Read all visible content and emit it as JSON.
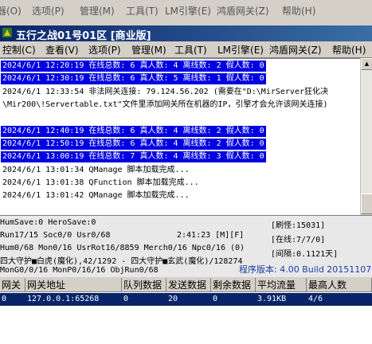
{
  "background_menu": {
    "items": [
      "器(O)",
      "选项(P)",
      "管理(M)",
      "工具(T)",
      "LM引擎(E)",
      "鸿盾网关(Z)",
      "帮助(H)"
    ]
  },
  "window": {
    "title": "五行之战01号01区 [商业版]"
  },
  "menu": {
    "items": [
      "控制(C)",
      "查看(V)",
      "选项(P)",
      "管理(M)",
      "工具(T)",
      "LM引擎(E)",
      "鸿盾网关(Z)",
      "帮助(H)"
    ]
  },
  "log": {
    "lines": [
      {
        "text": "2024/6/1 12:20:19 在线总数: 6 真人数: 4 离线数: 2 假人数: 0",
        "highlight": true
      },
      {
        "text": "2024/6/1 12:30:19 在线总数: 6 真人数: 5 离线数: 1 假人数: 0",
        "highlight": true
      },
      {
        "text": "2024/6/1 12:33:54 非法网关连接: 79.124.56.202 (需要在\"D:\\MirServer狂化决\\Mir200\\!Servertable.txt\"文件里添加网关所在机器的IP，引擎才会允许该网关连接)",
        "highlight": false
      },
      {
        "text": "2024/6/1 12:40:19 在线总数: 6 真人数: 4 离线数: 2 假人数: 0",
        "highlight": true
      },
      {
        "text": "2024/6/1 12:50:19 在线总数: 6 真人数: 4 离线数: 2 假人数: 0",
        "highlight": true
      },
      {
        "text": "2024/6/1 13:00:19 在线总数: 7 真人数: 4 离线数: 3 假人数: 0",
        "highlight": true
      },
      {
        "text": "2024/6/1 13:01:34 QManage 脚本加载完成...",
        "highlight": false
      },
      {
        "text": "2024/6/1 13:01:38 QFunction 脚本加载完成...",
        "highlight": false
      },
      {
        "text": "2024/6/1 13:01:42 QManage 脚本加载完成...",
        "highlight": false
      }
    ]
  },
  "status": {
    "save": "HumSave:0 HeroSave:0",
    "run": "Run17/15 Soc0/0 Usr0/68",
    "time": "2:41:23 [M][F]",
    "hum": "Hum0/68 Mon0/16 UsrRot16/8859 Merch0/16 Npc0/16 (0)",
    "map": "四大守护■白虎(魔化),42/1292 - 四大守护■玄武(魔化)/128274",
    "mon": "MonG0/0/16 MonP0/16/16 ObjRun0/68",
    "refresh": "[刷怪:15031]",
    "online": "[在线:7/7/0]",
    "interval": "[间隔:0.1121天]",
    "version": "程序版本: 4.00 Build 20151107"
  },
  "table": {
    "headers": [
      "网关",
      "网关地址",
      "队列数据",
      "发送数据",
      "剩余数据",
      "平均流量",
      "最高人数"
    ],
    "rows": [
      [
        "0",
        "127.0.0.1:65268",
        "0",
        "20",
        "0",
        "3.91KB",
        "4/6"
      ]
    ]
  },
  "colors": {
    "highlight": "#0000e0",
    "title_bar": "#0a246a",
    "version_text": "#1a3fa8"
  }
}
